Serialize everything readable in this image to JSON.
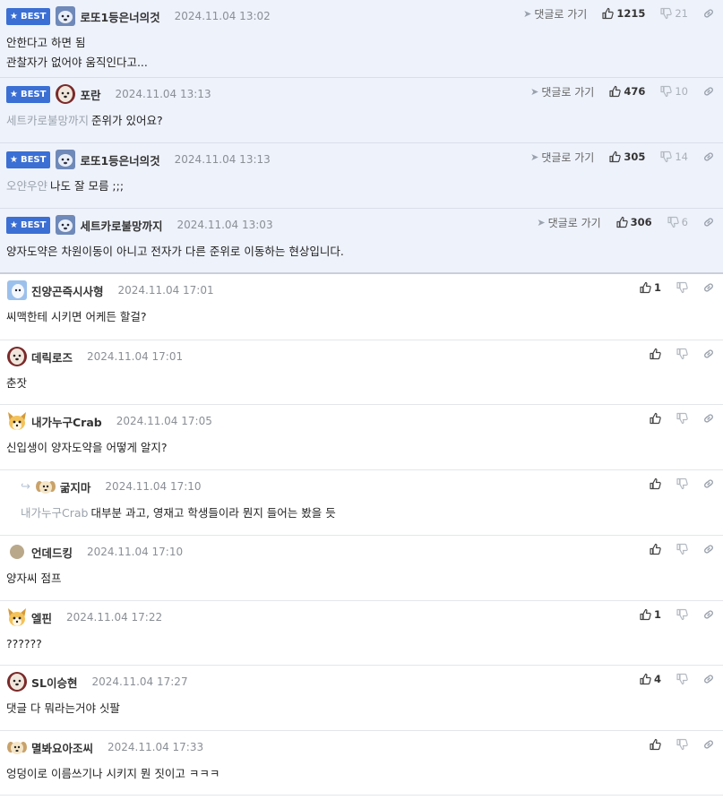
{
  "ui": {
    "best_label": "BEST",
    "goto_label": "댓글로 가기"
  },
  "comments": [
    {
      "best": true,
      "avatar": "dog-avatar",
      "nick": "로또1등은너의것",
      "date": "2024.11.04 13:02",
      "lines": [
        "안한다고 하면 됨",
        "관찰자가 없어야 움직인다고..."
      ],
      "likes": "1215",
      "dislikes": "21",
      "goto": true
    },
    {
      "best": true,
      "avatar": "pup-avatar",
      "nick": "포란",
      "date": "2024.11.04 13:13",
      "mention": "세트카로불망까지",
      "lines": [
        "준위가 있어요?"
      ],
      "likes": "476",
      "dislikes": "10",
      "goto": true
    },
    {
      "best": true,
      "avatar": "dog-avatar",
      "nick": "로또1등은너의것",
      "date": "2024.11.04 13:13",
      "mention": "오얀우얀",
      "lines": [
        "나도 잘 모름 ;;;"
      ],
      "likes": "305",
      "dislikes": "14",
      "goto": true
    },
    {
      "best": true,
      "avatar": "dog-avatar",
      "nick": "세트카로불망까지",
      "date": "2024.11.04 13:03",
      "lines": [
        "양자도약은 차원이동이 아니고 전자가 다른 준위로 이동하는 현상입니다."
      ],
      "likes": "306",
      "dislikes": "6",
      "goto": true
    },
    {
      "avatar": "blue-avatar",
      "nick": "진양곤즉시사형",
      "date": "2024.11.04 17:01",
      "lines": [
        "씨맥한테 시키면 어케든 할걸?"
      ],
      "likes": "1"
    },
    {
      "avatar": "pup-avatar",
      "nick": "데릭로즈",
      "date": "2024.11.04 17:01",
      "lines": [
        "춘잣"
      ]
    },
    {
      "avatar": "fox-avatar",
      "nick": "내가누구Crab",
      "date": "2024.11.04 17:05",
      "lines": [
        "신입생이 양자도약을 어떻게 알지?"
      ]
    },
    {
      "reply": true,
      "avatar": "puppy-avatar",
      "nick": "굶지마",
      "date": "2024.11.04 17:10",
      "mention": "내가누구Crab",
      "lines": [
        "대부분 과고, 영재고 학생들이라 뭔지 들어는 봤을 듯"
      ]
    },
    {
      "avatar": "dot-avatar",
      "nick": "언데드킹",
      "date": "2024.11.04 17:10",
      "lines": [
        "양자씨 점프"
      ]
    },
    {
      "avatar": "fox-avatar",
      "nick": "엘핀",
      "date": "2024.11.04 17:22",
      "lines": [
        "??????"
      ],
      "likes": "1"
    },
    {
      "avatar": "pup-avatar",
      "nick": "SL이승현",
      "date": "2024.11.04 17:27",
      "lines": [
        "댓글 다 뭐라는거야 싯팔"
      ],
      "likes": "4"
    },
    {
      "avatar": "puppy-avatar",
      "nick": "멸봐요아조씨",
      "date": "2024.11.04 17:33",
      "lines": [
        "엉덩이로 이름쓰기나 시키지 뭔 짓이고 ㅋㅋㅋ"
      ]
    }
  ]
}
